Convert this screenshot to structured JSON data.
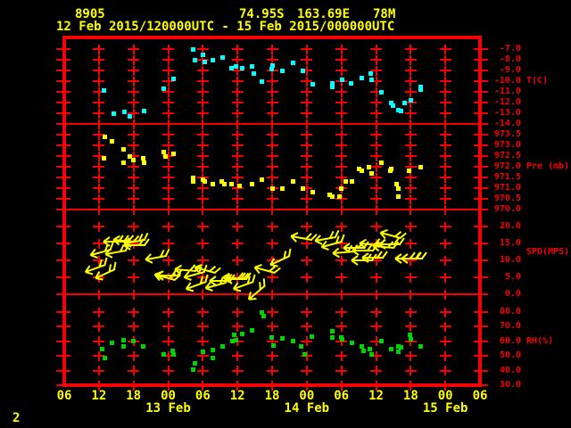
{
  "header": {
    "station_id": "8905",
    "latitude": "74.95S",
    "longitude": "163.69E",
    "elevation": "78M",
    "time_range": "12 Feb 2015/120000UTC - 15 Feb 2015/000000UTC"
  },
  "footer": {
    "page_number": "2"
  },
  "colors": {
    "background": "#000000",
    "grid": "#f80000",
    "annotation": "#ffff00",
    "temperature": "#00ffff",
    "pressure": "#ffff00",
    "wind": "#ffff00",
    "humidity": "#00d400"
  },
  "x_axis": {
    "start": "12 Feb 2015 0600UTC",
    "end": "15 Feb 2015 0600UTC",
    "hours_span": 72,
    "tick_interval_hours": 6,
    "hour_labels": [
      "06",
      "12",
      "18",
      "00",
      "06",
      "12",
      "18",
      "00",
      "06",
      "12",
      "18",
      "00",
      "06"
    ],
    "date_labels": [
      {
        "text": "13 Feb",
        "col": 3
      },
      {
        "text": "14 Feb",
        "col": 7
      },
      {
        "text": "15 Feb",
        "col": 11
      }
    ]
  },
  "chart_data": [
    {
      "type": "scatter",
      "name": "temperature",
      "unit_label": "T(C)",
      "unit_label_value": -10,
      "ylim": [
        -14,
        -6
      ],
      "yticks": [
        -7,
        -8,
        -9,
        -10,
        -11,
        -12,
        -13,
        -14
      ],
      "ytick_labels": [
        "-7.0",
        "-8.0",
        "-9.0",
        "-10.0",
        "-11.0",
        "-12.0",
        "-13.0",
        "-14.0"
      ],
      "points": [
        [
          6.8,
          -10.9
        ],
        [
          8.5,
          -13.0
        ],
        [
          10.4,
          -12.9
        ],
        [
          11.4,
          -13.3
        ],
        [
          13.8,
          -12.8
        ],
        [
          17.2,
          -10.7
        ],
        [
          19.0,
          -9.8
        ],
        [
          22.4,
          -7.0
        ],
        [
          22.6,
          -8.0
        ],
        [
          24.1,
          -7.5
        ],
        [
          24.3,
          -8.2
        ],
        [
          25.7,
          -8.0
        ],
        [
          27.4,
          -7.8
        ],
        [
          28.9,
          -8.8
        ],
        [
          29.7,
          -8.6
        ],
        [
          30.9,
          -8.8
        ],
        [
          32.5,
          -8.6
        ],
        [
          32.8,
          -9.3
        ],
        [
          34.3,
          -10.0
        ],
        [
          35.9,
          -8.9
        ],
        [
          36.0,
          -8.5
        ],
        [
          37.7,
          -9.0
        ],
        [
          39.6,
          -8.3
        ],
        [
          41.4,
          -9.0
        ],
        [
          43.0,
          -10.3
        ],
        [
          46.4,
          -10.2
        ],
        [
          46.5,
          -10.5
        ],
        [
          48.1,
          -9.9
        ],
        [
          49.6,
          -10.2
        ],
        [
          51.6,
          -9.7
        ],
        [
          53.0,
          -9.3
        ],
        [
          53.3,
          -9.9
        ],
        [
          55.0,
          -11.0
        ],
        [
          56.7,
          -12.0
        ],
        [
          57.0,
          -12.3
        ],
        [
          57.9,
          -12.7
        ],
        [
          58.3,
          -12.8
        ],
        [
          59.0,
          -12.0
        ],
        [
          60.1,
          -11.8
        ],
        [
          61.7,
          -10.5
        ],
        [
          61.8,
          -10.8
        ]
      ]
    },
    {
      "type": "scatter",
      "name": "pressure",
      "unit_label": "Pre (mb)",
      "unit_label_value": 972,
      "ylim": [
        970,
        974
      ],
      "yticks": [
        973.5,
        973.0,
        972.5,
        972.0,
        971.5,
        971.0,
        970.5,
        970.0
      ],
      "ytick_labels": [
        "973.5",
        "973.0",
        "972.5",
        "972.0",
        "971.5",
        "971.0",
        "970.5",
        "970.0"
      ],
      "points": [
        [
          6.8,
          972.4
        ],
        [
          7.0,
          973.4
        ],
        [
          8.3,
          973.2
        ],
        [
          10.2,
          972.8
        ],
        [
          10.2,
          972.2
        ],
        [
          11.4,
          972.5
        ],
        [
          11.9,
          972.3
        ],
        [
          13.6,
          972.4
        ],
        [
          13.9,
          972.2
        ],
        [
          17.2,
          972.7
        ],
        [
          17.5,
          972.5
        ],
        [
          18.9,
          972.6
        ],
        [
          22.4,
          971.5
        ],
        [
          22.4,
          971.3
        ],
        [
          24.0,
          971.4
        ],
        [
          24.3,
          971.3
        ],
        [
          25.7,
          971.2
        ],
        [
          27.2,
          971.3
        ],
        [
          27.7,
          971.2
        ],
        [
          28.9,
          971.2
        ],
        [
          30.4,
          971.1
        ],
        [
          32.5,
          971.2
        ],
        [
          34.3,
          971.4
        ],
        [
          36.0,
          971.0
        ],
        [
          37.7,
          971.0
        ],
        [
          39.6,
          971.3
        ],
        [
          41.3,
          971.0
        ],
        [
          43.0,
          970.8
        ],
        [
          46.0,
          970.7
        ],
        [
          46.5,
          970.6
        ],
        [
          47.7,
          970.6
        ],
        [
          47.9,
          971.0
        ],
        [
          48.7,
          971.3
        ],
        [
          49.9,
          971.3
        ],
        [
          51.1,
          971.9
        ],
        [
          51.6,
          971.8
        ],
        [
          52.7,
          972.0
        ],
        [
          53.3,
          971.7
        ],
        [
          55.0,
          972.2
        ],
        [
          56.4,
          971.8
        ],
        [
          56.6,
          971.9
        ],
        [
          57.5,
          971.2
        ],
        [
          57.8,
          971.0
        ],
        [
          57.9,
          970.6
        ],
        [
          59.7,
          971.8
        ],
        [
          61.7,
          972.0
        ]
      ]
    },
    {
      "type": "wind_barb",
      "name": "wind_speed",
      "unit_label": "SPD(MPS)",
      "unit_label_value": 12.5,
      "ylim": [
        0,
        25
      ],
      "yticks": [
        20,
        15,
        10,
        5,
        0
      ],
      "ytick_labels": [
        "20.0",
        "15.0",
        "10.0",
        "5.0",
        "0.0"
      ],
      "points": [
        [
          5.4,
          7.7,
          160
        ],
        [
          6.3,
          12.5,
          165
        ],
        [
          7.1,
          6.1,
          155
        ],
        [
          8.7,
          15.5,
          180
        ],
        [
          9.0,
          12.5,
          170
        ],
        [
          10.4,
          15.7,
          185
        ],
        [
          12.2,
          15.5,
          170
        ],
        [
          12.2,
          14.4,
          180
        ],
        [
          15.9,
          10.7,
          170
        ],
        [
          17.5,
          5.1,
          195
        ],
        [
          17.9,
          5.6,
          180
        ],
        [
          21.0,
          7.2,
          185
        ],
        [
          22.6,
          5.9,
          165
        ],
        [
          22.9,
          2.7,
          160
        ],
        [
          24.4,
          7.2,
          195
        ],
        [
          26.3,
          2.7,
          165
        ],
        [
          27.0,
          4.0,
          180
        ],
        [
          29.4,
          4.8,
          185
        ],
        [
          29.8,
          4.5,
          180
        ],
        [
          31.1,
          2.7,
          160
        ],
        [
          33.4,
          0.5,
          140
        ],
        [
          34.8,
          7.2,
          195
        ],
        [
          37.4,
          10.1,
          155
        ],
        [
          41.1,
          16.5,
          190
        ],
        [
          45.3,
          16.3,
          170
        ],
        [
          46.4,
          14.7,
          165
        ],
        [
          48.4,
          12.5,
          175
        ],
        [
          50.2,
          13.6,
          180
        ],
        [
          51.6,
          10.1,
          180
        ],
        [
          51.8,
          12.8,
          180
        ],
        [
          53.0,
          14.7,
          185
        ],
        [
          53.5,
          10.7,
          180
        ],
        [
          55.3,
          13.9,
          185
        ],
        [
          56.4,
          14.7,
          180
        ],
        [
          56.6,
          17.3,
          195
        ],
        [
          59.2,
          10.4,
          180
        ],
        [
          60.3,
          10.4,
          180
        ]
      ]
    },
    {
      "type": "scatter",
      "name": "relative_humidity",
      "unit_label": "RH(%)",
      "unit_label_value": 60,
      "ylim": [
        30,
        90
      ],
      "yticks": [
        80,
        70,
        60,
        50,
        40,
        30
      ],
      "ytick_labels": [
        "80.0",
        "70.0",
        "60.0",
        "50.0",
        "40.0",
        "30.0"
      ],
      "points": [
        [
          6.5,
          54.4
        ],
        [
          7.0,
          48.9
        ],
        [
          8.3,
          58.7
        ],
        [
          10.2,
          60.5
        ],
        [
          10.2,
          56.8
        ],
        [
          11.9,
          59.9
        ],
        [
          13.6,
          56.8
        ],
        [
          17.2,
          51.3
        ],
        [
          18.7,
          53.2
        ],
        [
          19.0,
          51.3
        ],
        [
          22.4,
          40.4
        ],
        [
          22.6,
          45.2
        ],
        [
          24.1,
          52.6
        ],
        [
          25.7,
          48.3
        ],
        [
          25.8,
          53.8
        ],
        [
          27.4,
          56.8
        ],
        [
          29.1,
          59.9
        ],
        [
          29.4,
          64.2
        ],
        [
          29.8,
          60.5
        ],
        [
          30.9,
          64.8
        ],
        [
          32.6,
          67.8
        ],
        [
          34.2,
          80.0
        ],
        [
          34.5,
          77.0
        ],
        [
          35.9,
          62.9
        ],
        [
          36.2,
          57.4
        ],
        [
          37.7,
          62.3
        ],
        [
          39.6,
          59.9
        ],
        [
          41.0,
          56.8
        ],
        [
          41.6,
          51.3
        ],
        [
          42.8,
          63.5
        ],
        [
          46.4,
          66.6
        ],
        [
          46.5,
          62.9
        ],
        [
          47.9,
          62.9
        ],
        [
          48.2,
          61.7
        ],
        [
          49.8,
          58.7
        ],
        [
          51.6,
          56.8
        ],
        [
          51.8,
          53.2
        ],
        [
          52.9,
          54.4
        ],
        [
          53.2,
          51.3
        ],
        [
          55.0,
          59.9
        ],
        [
          56.6,
          54.4
        ],
        [
          57.8,
          56.8
        ],
        [
          57.9,
          52.6
        ],
        [
          58.3,
          56.2
        ],
        [
          59.8,
          64.2
        ],
        [
          60.1,
          61.1
        ],
        [
          61.8,
          56.8
        ]
      ]
    }
  ]
}
